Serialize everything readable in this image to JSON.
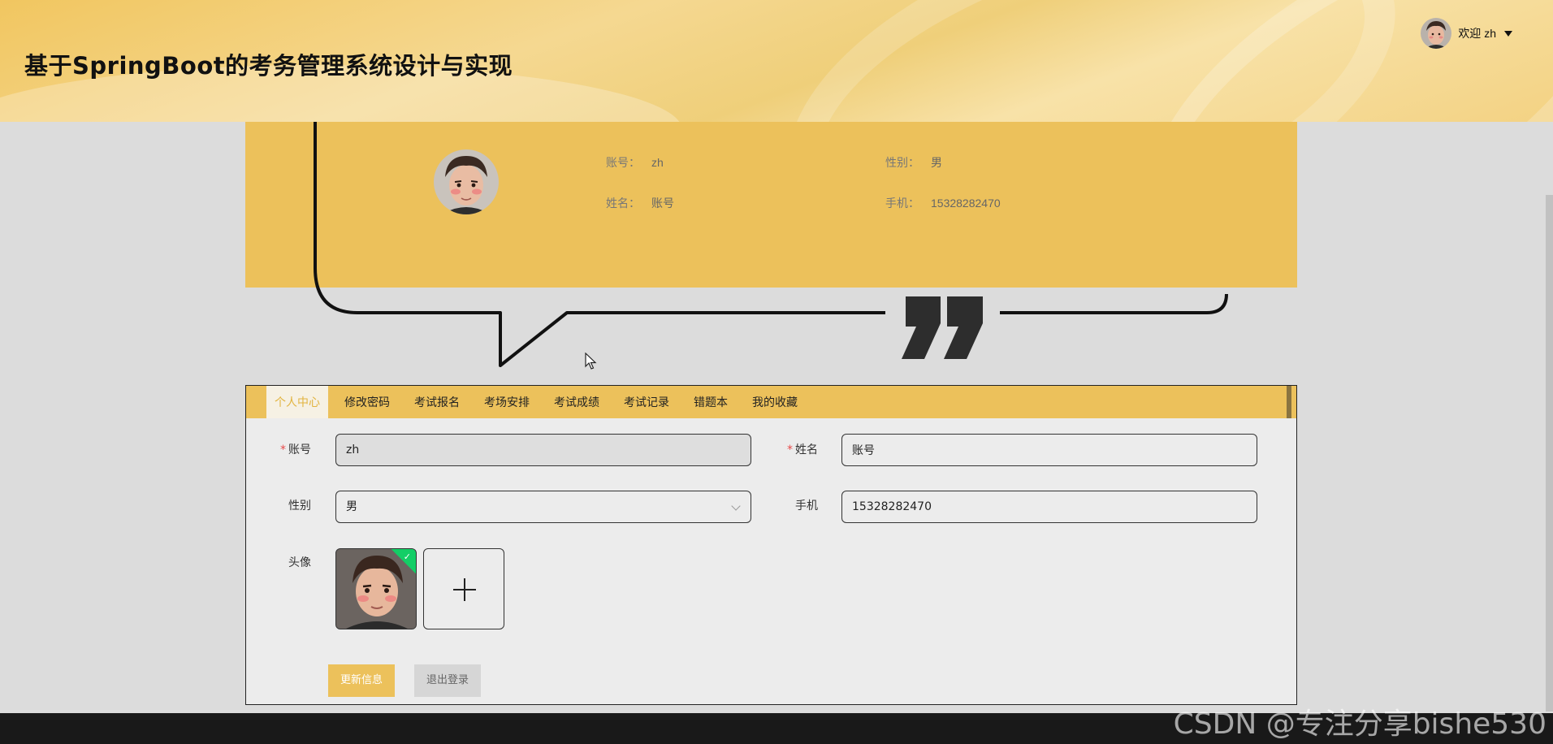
{
  "header": {
    "title": "基于SpringBoot的考务管理系统设计与实现",
    "welcome": "欢迎 zh"
  },
  "profile": {
    "account_label": "账号：",
    "account": "zh",
    "gender_label": "性别：",
    "gender": "男",
    "name_label": "姓名：",
    "name": "账号",
    "phone_label": "手机：",
    "phone": "15328282470"
  },
  "tabs": [
    {
      "label": "个人中心",
      "active": true
    },
    {
      "label": "修改密码",
      "active": false
    },
    {
      "label": "考试报名",
      "active": false
    },
    {
      "label": "考场安排",
      "active": false
    },
    {
      "label": "考试成绩",
      "active": false
    },
    {
      "label": "考试记录",
      "active": false
    },
    {
      "label": "错题本",
      "active": false
    },
    {
      "label": "我的收藏",
      "active": false
    }
  ],
  "form": {
    "account_label": "账号",
    "account_value": "zh",
    "name_label": "姓名",
    "name_value": "账号",
    "gender_label": "性别",
    "gender_value": "男",
    "phone_label": "手机",
    "phone_value": "15328282470",
    "avatar_label": "头像",
    "update_button": "更新信息",
    "logout_button": "退出登录"
  },
  "watermark": "CSDN @专注分享bishe530",
  "colors": {
    "accent": "#ecc15b",
    "active_tab_text": "#e2b440",
    "required": "#e84a4a",
    "upload_success": "#13ce66",
    "footer": "#191919"
  }
}
